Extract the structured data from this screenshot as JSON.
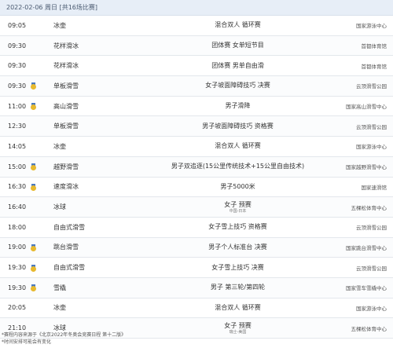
{
  "header": {
    "title": "2022-02-06 周日 [共16场比赛]"
  },
  "rows": [
    {
      "time": "09:05",
      "medal": false,
      "sport": "冰壶",
      "event": "混合双人 循环赛",
      "sub": "",
      "venue": "国家游泳中心"
    },
    {
      "time": "09:30",
      "medal": false,
      "sport": "花样滑冰",
      "event": "团体赛 女单短节目",
      "sub": "",
      "venue": "首都体育馆"
    },
    {
      "time": "09:30",
      "medal": false,
      "sport": "花样滑冰",
      "event": "团体赛 男单自由滑",
      "sub": "",
      "venue": "首都体育馆"
    },
    {
      "time": "09:30",
      "medal": true,
      "sport": "单板滑雪",
      "event": "女子坡面障碍技巧 决赛",
      "sub": "",
      "venue": "云顶滑雪公园"
    },
    {
      "time": "11:00",
      "medal": true,
      "sport": "高山滑雪",
      "event": "男子滑降",
      "sub": "",
      "venue": "国家高山滑雪中心"
    },
    {
      "time": "12:30",
      "medal": false,
      "sport": "单板滑雪",
      "event": "男子坡面障碍技巧 资格赛",
      "sub": "",
      "venue": "云顶滑雪公园"
    },
    {
      "time": "14:05",
      "medal": false,
      "sport": "冰壶",
      "event": "混合双人 循环赛",
      "sub": "",
      "venue": "国家游泳中心"
    },
    {
      "time": "15:00",
      "medal": true,
      "sport": "越野滑雪",
      "event": "男子双追逐(15公里传统技术+15公里自由技术)",
      "sub": "",
      "venue": "国家越野滑雪中心"
    },
    {
      "time": "16:30",
      "medal": true,
      "sport": "速度滑冰",
      "event": "男子5000米",
      "sub": "",
      "venue": "国家速滑馆"
    },
    {
      "time": "16:40",
      "medal": false,
      "sport": "冰球",
      "event": "女子 预赛",
      "sub": "中国-日本",
      "venue": "五棵松体育中心"
    },
    {
      "time": "18:00",
      "medal": false,
      "sport": "自由式滑雪",
      "event": "女子雪上技巧 资格赛",
      "sub": "",
      "venue": "云顶滑雪公园"
    },
    {
      "time": "19:00",
      "medal": true,
      "sport": "跳台滑雪",
      "event": "男子个人标准台 决赛",
      "sub": "",
      "venue": "国家跳台滑雪中心"
    },
    {
      "time": "19:30",
      "medal": true,
      "sport": "自由式滑雪",
      "event": "女子雪上技巧 决赛",
      "sub": "",
      "venue": "云顶滑雪公园"
    },
    {
      "time": "19:30",
      "medal": true,
      "sport": "雪橇",
      "event": "男子 第三轮/第四轮",
      "sub": "",
      "venue": "国家雪车雪橇中心"
    },
    {
      "time": "20:05",
      "medal": false,
      "sport": "冰壶",
      "event": "混合双人 循环赛",
      "sub": "",
      "venue": "国家游泳中心"
    },
    {
      "time": "21:10",
      "medal": false,
      "sport": "冰球",
      "event": "女子 预赛",
      "sub": "瑞士-美国",
      "venue": "五棵松体育中心"
    }
  ],
  "notes": {
    "line1": "*赛程内容来源于《北京2022年冬奥会竞赛日程 第十二版》",
    "line2": "*时间安排可能会有变化"
  }
}
